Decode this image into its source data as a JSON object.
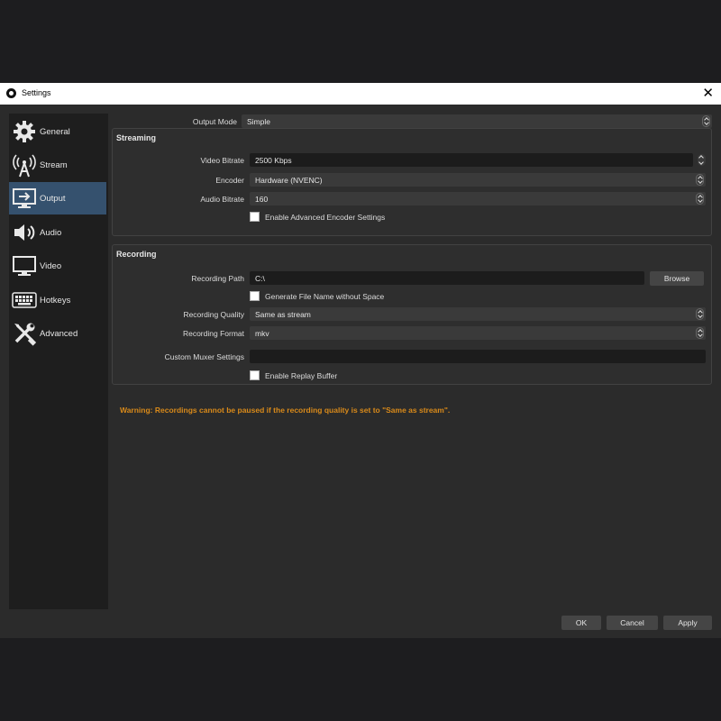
{
  "window": {
    "title": "Settings",
    "close_glyph": "✕"
  },
  "sidebar": {
    "items": [
      {
        "label": "General",
        "icon": "gear-icon",
        "active": false
      },
      {
        "label": "Stream",
        "icon": "antenna-icon",
        "active": false
      },
      {
        "label": "Output",
        "icon": "output-monitor-icon",
        "active": true
      },
      {
        "label": "Audio",
        "icon": "speaker-icon",
        "active": false
      },
      {
        "label": "Video",
        "icon": "monitor-icon",
        "active": false
      },
      {
        "label": "Hotkeys",
        "icon": "keyboard-icon",
        "active": false
      },
      {
        "label": "Advanced",
        "icon": "tools-icon",
        "active": false
      }
    ]
  },
  "output_mode": {
    "label": "Output Mode",
    "value": "Simple"
  },
  "streaming": {
    "title": "Streaming",
    "video_bitrate": {
      "label": "Video Bitrate",
      "value": "2500 Kbps"
    },
    "encoder": {
      "label": "Encoder",
      "value": "Hardware (NVENC)"
    },
    "audio_bitrate": {
      "label": "Audio Bitrate",
      "value": "160"
    },
    "advanced_encoder": {
      "label": "Enable Advanced Encoder Settings",
      "checked": false
    }
  },
  "recording": {
    "title": "Recording",
    "path": {
      "label": "Recording Path",
      "value": "C:\\"
    },
    "browse_label": "Browse",
    "filename_nospace": {
      "label": "Generate File Name without Space",
      "checked": false
    },
    "quality": {
      "label": "Recording Quality",
      "value": "Same as stream"
    },
    "format": {
      "label": "Recording Format",
      "value": "mkv"
    },
    "muxer": {
      "label": "Custom Muxer Settings",
      "value": ""
    },
    "replay_buffer": {
      "label": "Enable Replay Buffer",
      "checked": false
    }
  },
  "warning": "Warning: Recordings cannot be paused if the recording quality is set to \"Same as stream\".",
  "buttons": {
    "ok": "OK",
    "cancel": "Cancel",
    "apply": "Apply"
  },
  "colors": {
    "accent": "#35516e",
    "warning": "#d98a1a",
    "background": "#2b2b2b"
  }
}
